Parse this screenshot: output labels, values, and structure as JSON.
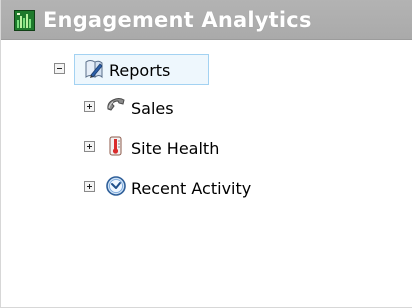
{
  "window": {
    "title": "Engagement Analytics",
    "app_icon": "bar-chart-icon"
  },
  "tree": {
    "root": {
      "label": "Reports",
      "icon": "document-pen-icon",
      "expanded": true,
      "selected": true,
      "children": [
        {
          "label": "Sales",
          "icon": "telephone-icon",
          "expanded": false
        },
        {
          "label": "Site Health",
          "icon": "thermometer-icon",
          "expanded": false
        },
        {
          "label": "Recent Activity",
          "icon": "clock-icon",
          "expanded": false
        }
      ]
    }
  },
  "colors": {
    "titlebar": "#aaaaaa",
    "title_text": "#ffffff",
    "selection_border": "#a3d2f2",
    "selection_fill": "#eef7fd"
  }
}
